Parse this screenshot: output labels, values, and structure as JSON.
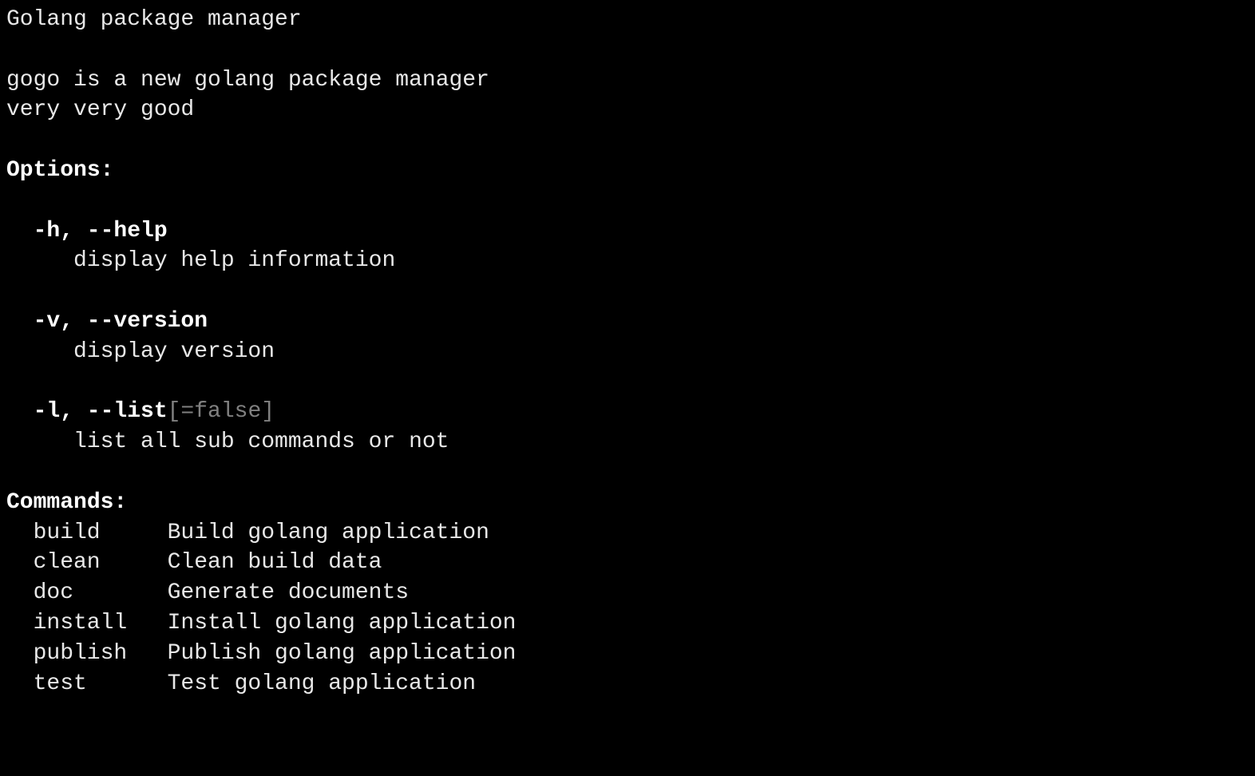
{
  "title": "Golang package manager",
  "description_line1": "gogo is a new golang package manager",
  "description_line2": "very very good",
  "options_header": "Options:",
  "options": [
    {
      "flags": "-h, --help",
      "default": "",
      "desc": "display help information"
    },
    {
      "flags": "-v, --version",
      "default": "",
      "desc": "display version"
    },
    {
      "flags": "-l, --list",
      "default": "[=false]",
      "desc": "list all sub commands or not"
    }
  ],
  "commands_header": "Commands:",
  "commands": [
    {
      "name": "build",
      "desc": "Build golang application"
    },
    {
      "name": "clean",
      "desc": "Clean build data"
    },
    {
      "name": "doc",
      "desc": "Generate documents"
    },
    {
      "name": "install",
      "desc": "Install golang application"
    },
    {
      "name": "publish",
      "desc": "Publish golang application"
    },
    {
      "name": "test",
      "desc": "Test golang application"
    }
  ]
}
